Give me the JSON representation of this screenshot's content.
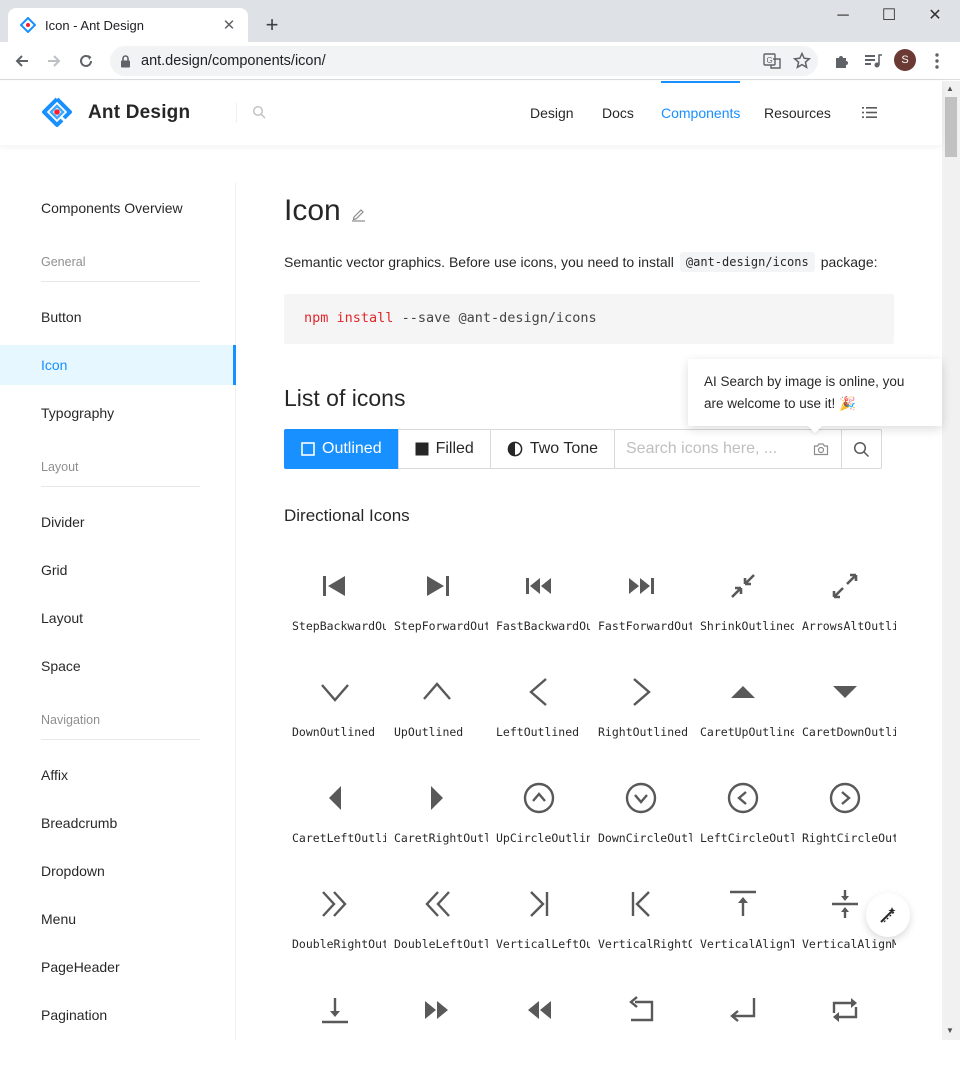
{
  "browser": {
    "tab_title": "Icon - Ant Design",
    "tab_close": "✕",
    "new_tab": "+",
    "url": "ant.design/components/icon/",
    "profile_initial": "S",
    "window": {
      "minimize": "─",
      "maximize": "☐",
      "close": "✕"
    }
  },
  "header": {
    "logo_text": "Ant Design",
    "nav": [
      "Design",
      "Docs",
      "Components",
      "Resources"
    ],
    "active_nav": "Components"
  },
  "sidebar": {
    "overview": "Components Overview",
    "groups": [
      {
        "title": "General",
        "items": [
          "Button",
          "Icon",
          "Typography"
        ]
      },
      {
        "title": "Layout",
        "items": [
          "Divider",
          "Grid",
          "Layout",
          "Space"
        ]
      },
      {
        "title": "Navigation",
        "items": [
          "Affix",
          "Breadcrumb",
          "Dropdown",
          "Menu",
          "PageHeader",
          "Pagination"
        ]
      }
    ],
    "active_item": "Icon"
  },
  "main": {
    "title": "Icon",
    "intro_before": "Semantic vector graphics. Before use icons, you need to install",
    "intro_code": "@ant-design/icons",
    "intro_after": "package:",
    "code": {
      "kw1": "npm",
      "kw2": "install",
      "rest": "--save @ant-design/icons"
    },
    "list_title": "List of icons",
    "themes": [
      "Outlined",
      "Filled",
      "Two Tone"
    ],
    "active_theme": "Outlined",
    "search_placeholder": "Search icons here, ...",
    "tooltip": "AI Search by image is online, you are welcome to use it! 🎉",
    "section_title": "Directional Icons",
    "icons": [
      {
        "label": "StepBackwardOutlined",
        "icon": "step-backward"
      },
      {
        "label": "StepForwardOutlined",
        "icon": "step-forward"
      },
      {
        "label": "FastBackwardOutlined",
        "icon": "fast-backward"
      },
      {
        "label": "FastForwardOutlined",
        "icon": "fast-forward"
      },
      {
        "label": "ShrinkOutlined",
        "icon": "shrink"
      },
      {
        "label": "ArrowsAltOutlined",
        "icon": "arrows-alt"
      },
      {
        "label": "DownOutlined",
        "icon": "down"
      },
      {
        "label": "UpOutlined",
        "icon": "up"
      },
      {
        "label": "LeftOutlined",
        "icon": "left"
      },
      {
        "label": "RightOutlined",
        "icon": "right"
      },
      {
        "label": "CaretUpOutlined",
        "icon": "caret-up"
      },
      {
        "label": "CaretDownOutlined",
        "icon": "caret-down"
      },
      {
        "label": "CaretLeftOutlined",
        "icon": "caret-left"
      },
      {
        "label": "CaretRightOutlined",
        "icon": "caret-right"
      },
      {
        "label": "UpCircleOutlined",
        "icon": "up-circle"
      },
      {
        "label": "DownCircleOutlined",
        "icon": "down-circle"
      },
      {
        "label": "LeftCircleOutlined",
        "icon": "left-circle"
      },
      {
        "label": "RightCircleOutlined",
        "icon": "right-circle"
      },
      {
        "label": "DoubleRightOutlined",
        "icon": "double-right"
      },
      {
        "label": "DoubleLeftOutlined",
        "icon": "double-left"
      },
      {
        "label": "VerticalLeftOutlined",
        "icon": "vertical-left"
      },
      {
        "label": "VerticalRightOutlined",
        "icon": "vertical-right"
      },
      {
        "label": "VerticalAlignTopOutlined",
        "icon": "vertical-align-top"
      },
      {
        "label": "VerticalAlignMiddleOutlined",
        "icon": "vertical-align-middle"
      },
      {
        "label": "",
        "icon": "vertical-align-bottom"
      },
      {
        "label": "",
        "icon": "forward"
      },
      {
        "label": "",
        "icon": "backward"
      },
      {
        "label": "",
        "icon": "rollback"
      },
      {
        "label": "",
        "icon": "enter"
      },
      {
        "label": "",
        "icon": "retweet"
      }
    ]
  },
  "colors": {
    "primary": "#1890ff",
    "active_bg": "#e6f7ff",
    "code_keyword": "#e0282e"
  }
}
